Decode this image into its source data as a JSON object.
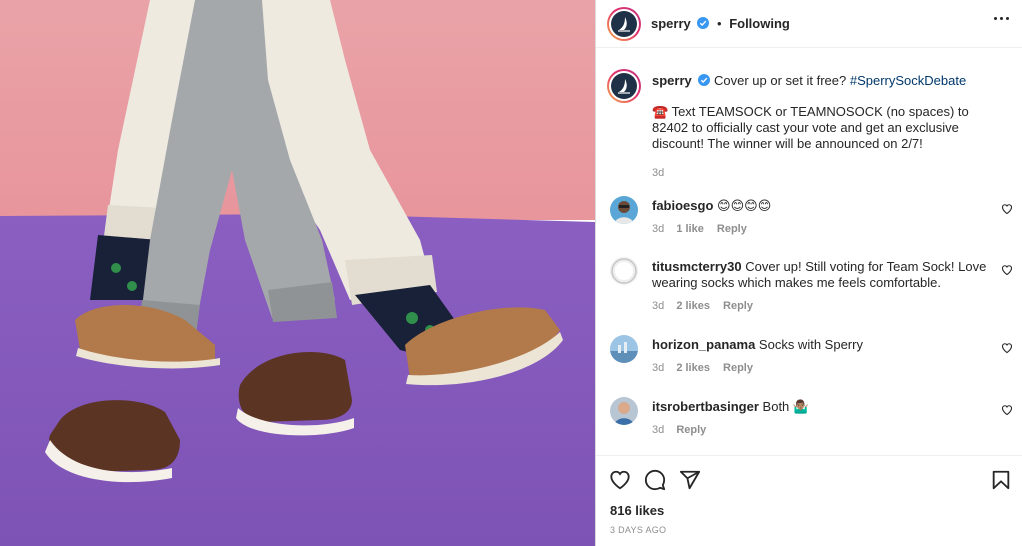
{
  "post": {
    "username": "sperry",
    "follow_state": "Following",
    "separator": "•"
  },
  "caption": {
    "username": "sperry",
    "text_before": "Cover up or set it free?",
    "hashtag": "#SperrySockDebate",
    "emoji": "☎️",
    "text_body": "Text TEAMSOCK or TEAMNOSOCK (no spaces) to 82402 to officially cast your vote and get an exclusive discount! The winner will be announced on 2/7!",
    "time": "3d"
  },
  "comments": [
    {
      "username": "fabioesgo",
      "text": "😊😊😊😊",
      "time": "3d",
      "likes": "1 like",
      "reply": "Reply"
    },
    {
      "username": "titusmcterry30",
      "text": "Cover up! Still voting for Team Sock! Love wearing socks which makes me feels comfortable.",
      "time": "3d",
      "likes": "2 likes",
      "reply": "Reply"
    },
    {
      "username": "horizon_panama",
      "text": "Socks with Sperry",
      "time": "3d",
      "likes": "2 likes",
      "reply": "Reply"
    },
    {
      "username": "itsrobertbasinger",
      "text": "Both 🤷🏽‍♂️",
      "time": "3d",
      "likes": "",
      "reply": "Reply"
    }
  ],
  "footer": {
    "likes": "816 likes",
    "date": "3 DAYS AGO"
  },
  "icons": {
    "more": "more-options-icon",
    "verified": "verified-badge-icon",
    "like": "heart-icon",
    "comment": "comment-icon",
    "share": "share-icon",
    "save": "bookmark-icon"
  },
  "colors": {
    "verified": "#3897f0",
    "hashtag": "#00376b",
    "meta": "#8e8e8e",
    "brand_avatar": "#1f3146"
  }
}
